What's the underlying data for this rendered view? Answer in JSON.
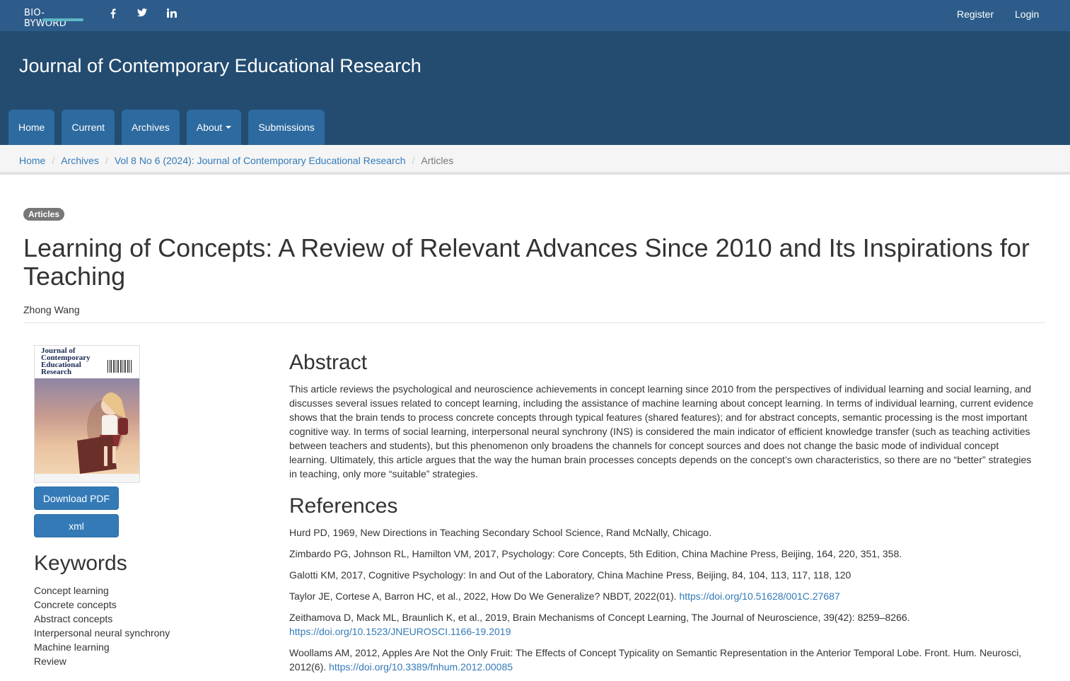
{
  "topbar": {
    "logo_text": "BIO-BYWORD",
    "social_icons": [
      "facebook-icon",
      "twitter-icon",
      "linkedin-icon"
    ],
    "register": "Register",
    "login": "Login"
  },
  "header": {
    "site_title": "Journal of Contemporary Educational Research",
    "nav": [
      {
        "label": "Home"
      },
      {
        "label": "Current"
      },
      {
        "label": "Archives"
      },
      {
        "label": "About"
      },
      {
        "label": "Submissions"
      }
    ]
  },
  "breadcrumb": {
    "items": [
      "Home",
      "Archives",
      "Vol 8 No 6 (2024): Journal of Contemporary Educational Research"
    ],
    "current": "Articles"
  },
  "article": {
    "section_badge": "Articles",
    "title": "Learning of Concepts: A Review of Relevant Advances Since 2010 and Its Inspirations for Teaching",
    "author": "Zhong Wang",
    "cover_title": "Journal of\nContemporary\nEducational\nResearch",
    "download_pdf": "Download PDF",
    "xml": "xml",
    "keywords_heading": "Keywords",
    "keywords": [
      "Concept learning",
      "Concrete concepts",
      "Abstract concepts",
      "Interpersonal neural synchrony",
      "Machine learning",
      "Review"
    ],
    "abstract_heading": "Abstract",
    "abstract": "This article reviews the psychological and neuroscience achievements in concept learning since 2010 from the perspectives of individual learning and social learning, and discusses several issues related to concept learning, including the assistance of machine learning about concept learning. In terms of individual learning, current evidence shows that the brain tends to process concrete concepts through typical features (shared features); and for abstract concepts, semantic processing is the most important cognitive way. In terms of social learning, interpersonal neural synchrony (INS) is considered the main indicator of efficient knowledge transfer (such as teaching activities between teachers and students), but this phenomenon only broadens the channels for concept sources and does not change the basic mode of individual concept learning. Ultimately, this article argues that the way the human brain processes concepts depends on the concept’s own characteristics, so there are no “better” strategies in teaching, only more “suitable” strategies.",
    "references_heading": "References",
    "references": [
      {
        "text": "Hurd PD, 1969, New Directions in Teaching Secondary School Science, Rand McNally, Chicago.",
        "link": ""
      },
      {
        "text": "Zimbardo PG, Johnson RL, Hamilton VM, 2017, Psychology: Core Concepts, 5th Edition, China Machine Press, Beijing, 164, 220, 351, 358.",
        "link": ""
      },
      {
        "text": "Galotti KM, 2017, Cognitive Psychology: In and Out of the Laboratory, China Machine Press, Beijing, 84, 104, 113, 117, 118, 120",
        "link": ""
      },
      {
        "text": "Taylor JE, Cortese A, Barron HC, et al., 2022, How Do We Generalize? NBDT, 2022(01). ",
        "link": "https://doi.org/10.51628/001C.27687"
      },
      {
        "text": "Zeithamova D, Mack ML, Braunlich K, et al., 2019, Brain Mechanisms of Concept Learning, The Journal of Neuroscience, 39(42): 8259–8266. ",
        "link": "https://doi.org/10.1523/JNEUROSCI.1166-19.2019"
      },
      {
        "text": "Woollams AM, 2012, Apples Are Not the Only Fruit: The Effects of Concept Typicality on Semantic Representation in the Anterior Temporal Lobe. Front. Hum. Neurosci, 2012(6). ",
        "link": "https://doi.org/10.3389/fnhum.2012.00085"
      }
    ]
  },
  "colors": {
    "topbar": "#2d5c8a",
    "header": "#234c70",
    "nav_tab": "#2d6a9f",
    "link": "#337ab7",
    "button": "#337ab7"
  }
}
